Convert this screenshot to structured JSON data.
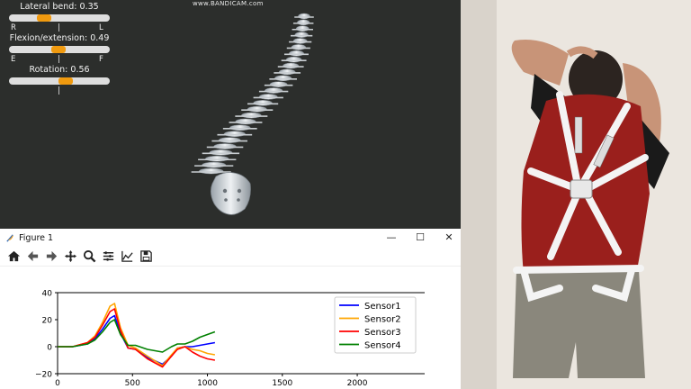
{
  "viewer": {
    "watermark": "www.BANDICAM.com",
    "sliders": [
      {
        "label": "Lateral bend:",
        "value": "0.35",
        "fraction": 0.35,
        "left": "R",
        "mid": "|",
        "right": "L"
      },
      {
        "label": "Flexion/extension:",
        "value": "0.49",
        "fraction": 0.49,
        "left": "E",
        "mid": "|",
        "right": "F"
      },
      {
        "label": "Rotation:",
        "value": "0.56",
        "fraction": 0.56,
        "left": "",
        "mid": "|",
        "right": ""
      }
    ]
  },
  "figure_window": {
    "title": "Figure 1",
    "controls": [
      "minimize-icon",
      "maximize-icon",
      "close-icon"
    ],
    "toolbar": [
      "home-icon",
      "back-arrow-icon",
      "forward-arrow-icon",
      "pan-icon",
      "zoom-icon",
      "configure-subplots-icon",
      "edit-axis-icon",
      "save-icon"
    ]
  },
  "chart_data": {
    "type": "line",
    "title": "",
    "xlabel": "",
    "ylabel": "",
    "xlim": [
      0,
      2450
    ],
    "ylim": [
      -20,
      40
    ],
    "xticks": [
      "0",
      "500",
      "1000",
      "1500",
      "2000"
    ],
    "yticks": [
      "40",
      "20",
      "0",
      "−20"
    ],
    "legend_position": "upper-right",
    "series": [
      {
        "name": "Sensor1",
        "color": "#0000ff",
        "x": [
          0,
          100,
          200,
          250,
          300,
          350,
          380,
          420,
          470,
          520,
          600,
          700,
          760,
          800,
          850,
          900,
          950,
          1000,
          1050
        ],
        "y": [
          0,
          0,
          2,
          6,
          13,
          21,
          23,
          10,
          -1,
          -2,
          -8,
          -13,
          -7,
          -1,
          0,
          0,
          1,
          2,
          3
        ]
      },
      {
        "name": "Sensor2",
        "color": "#ffa500",
        "x": [
          0,
          100,
          200,
          250,
          300,
          350,
          380,
          420,
          470,
          520,
          600,
          700,
          760,
          800,
          850,
          900,
          950,
          1000,
          1050
        ],
        "y": [
          0,
          0,
          3,
          8,
          18,
          30,
          32,
          14,
          1,
          -1,
          -7,
          -14,
          -6,
          -1,
          0,
          -2,
          -3,
          -5,
          -6
        ]
      },
      {
        "name": "Sensor3",
        "color": "#ff0000",
        "x": [
          0,
          100,
          200,
          250,
          300,
          350,
          380,
          420,
          470,
          520,
          600,
          700,
          760,
          800,
          850,
          900,
          950,
          1000,
          1050
        ],
        "y": [
          0,
          0,
          3,
          7,
          16,
          26,
          28,
          12,
          -1,
          -2,
          -9,
          -15,
          -7,
          -2,
          0,
          -4,
          -7,
          -9,
          -10
        ]
      },
      {
        "name": "Sensor4",
        "color": "#008000",
        "x": [
          0,
          100,
          200,
          250,
          300,
          350,
          380,
          420,
          470,
          520,
          600,
          700,
          760,
          800,
          850,
          900,
          950,
          1000,
          1050
        ],
        "y": [
          0,
          0,
          2,
          5,
          11,
          18,
          20,
          9,
          1,
          1,
          -2,
          -4,
          0,
          2,
          2,
          4,
          7,
          9,
          11
        ]
      }
    ]
  }
}
